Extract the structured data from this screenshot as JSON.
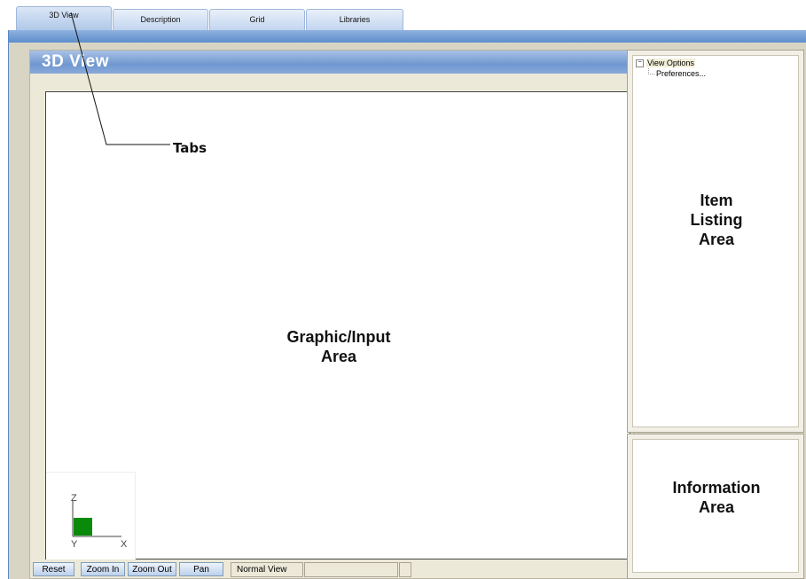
{
  "tabs": [
    {
      "label": "3D View",
      "active": true
    },
    {
      "label": "Description",
      "active": false
    },
    {
      "label": "Grid",
      "active": false
    },
    {
      "label": "Libraries",
      "active": false
    }
  ],
  "main_panel": {
    "title": "3D View",
    "graphic_area_label_line1": "Graphic/Input",
    "graphic_area_label_line2": "Area",
    "axis": {
      "z": "Z",
      "y": "Y",
      "x": "X"
    }
  },
  "toolbar": {
    "buttons": [
      "Reset",
      "Zoom In",
      "Zoom Out",
      "Pan"
    ],
    "view_mode": "Normal View"
  },
  "item_listing": {
    "tree_root": "View Options",
    "tree_child": "Preferences...",
    "label_line1": "Item",
    "label_line2": "Listing",
    "label_line3": "Area"
  },
  "info_area": {
    "label_line1": "Information",
    "label_line2": "Area"
  },
  "annotations": {
    "tabs_callout": "Tabs"
  },
  "colors": {
    "title_bar": "#6f97d0",
    "frame_bar": "#5e8ecb",
    "axis_square": "#0a8a0a"
  }
}
